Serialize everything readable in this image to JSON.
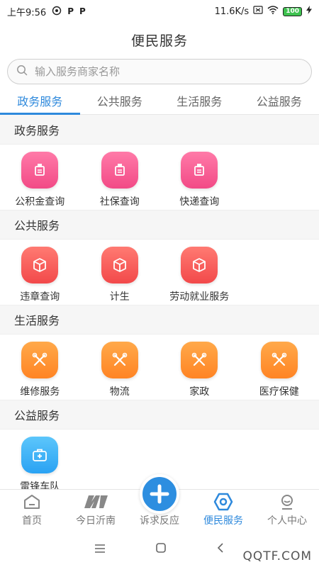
{
  "status_bar": {
    "time": "上午9:56",
    "left_icons": [
      "P",
      "P"
    ],
    "network_speed": "11.6K/s",
    "battery": "100"
  },
  "title": "便民服务",
  "search": {
    "placeholder": "输入服务商家名称"
  },
  "tabs": [
    {
      "label": "政务服务",
      "active": true
    },
    {
      "label": "公共服务",
      "active": false
    },
    {
      "label": "生活服务",
      "active": false
    },
    {
      "label": "公益服务",
      "active": false
    }
  ],
  "sections": [
    {
      "title": "政务服务",
      "items": [
        {
          "label": "公积金查询",
          "icon": "document-icon",
          "color": "pink"
        },
        {
          "label": "社保查询",
          "icon": "document-icon",
          "color": "pink"
        },
        {
          "label": "快递查询",
          "icon": "document-icon",
          "color": "pink"
        }
      ]
    },
    {
      "title": "公共服务",
      "items": [
        {
          "label": "违章查询",
          "icon": "box-icon",
          "color": "red"
        },
        {
          "label": "计生",
          "icon": "box-icon",
          "color": "red"
        },
        {
          "label": "劳动就业服务",
          "icon": "box-icon",
          "color": "red"
        }
      ]
    },
    {
      "title": "生活服务",
      "items": [
        {
          "label": "维修服务",
          "icon": "tools-icon",
          "color": "orange"
        },
        {
          "label": "物流",
          "icon": "tools-icon",
          "color": "orange"
        },
        {
          "label": "家政",
          "icon": "tools-icon",
          "color": "orange"
        },
        {
          "label": "医疗保健",
          "icon": "tools-icon",
          "color": "orange"
        }
      ]
    },
    {
      "title": "公益服务",
      "items": [
        {
          "label": "雷锋车队",
          "icon": "medkit-icon",
          "color": "blue"
        }
      ]
    }
  ],
  "bottom_nav": [
    {
      "label": "首页",
      "icon": "home-icon",
      "active": false
    },
    {
      "label": "今日沂南",
      "icon": "logo-icon",
      "active": false
    },
    {
      "label": "诉求反应",
      "icon": "plus-icon",
      "active": false
    },
    {
      "label": "便民服务",
      "icon": "hexagon-icon",
      "active": true
    },
    {
      "label": "个人中心",
      "icon": "person-icon",
      "active": false
    }
  ],
  "colors": {
    "accent": "#2e89dc",
    "pink": "#f24a86",
    "red": "#f2494a",
    "orange": "#ff8424",
    "blue": "#2aa2f3"
  },
  "watermark": "QQTF.COM"
}
